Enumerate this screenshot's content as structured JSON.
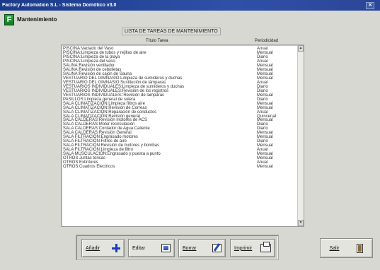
{
  "window": {
    "title": "Factory Automation S.L - Sistema Domótico v3.0",
    "close_symbol": "✕"
  },
  "app": {
    "icon_letter": "F",
    "section_title": "Mantenimiento"
  },
  "list": {
    "caption": "LISTA DE TAREAS DE MANTENIMIENTO",
    "columns": [
      "Título Tarea",
      "Periodicidad"
    ],
    "selected_index": 33,
    "rows": [
      {
        "task": "PISCINA:Vaciado del Vaso",
        "period": "Anual"
      },
      {
        "task": "PISCINA:Limpieza de tubos y rejillas de aire",
        "period": "Mensual"
      },
      {
        "task": "PISCINA:Limpieza de la playa",
        "period": "Diario"
      },
      {
        "task": "PISCINA:Limpieza del vaso",
        "period": "Anual"
      },
      {
        "task": "SAUNA:Revisión ventilador",
        "period": "Mensual"
      },
      {
        "task": "SAUNA:Revisión de cebolletas",
        "period": "Mensual"
      },
      {
        "task": "SAUNA:Revisión de cajón de Sauna",
        "period": "Mensual"
      },
      {
        "task": "VESTUARIO DEL GIMNASIO:Limpieza de sumideros y duchas",
        "period": "Mensual"
      },
      {
        "task": "VESTUARIO DEL GIMNASIO:Sustitución de lámparas",
        "period": "Anual"
      },
      {
        "task": "VESTUARIOS INDIVIDUALES:Limpieza de sumideros y duchas",
        "period": "Diario"
      },
      {
        "task": "VESTUARIOS INDIVIDUALES:Revisión de los registros",
        "period": "Diario"
      },
      {
        "task": "VESTUARIOS INDIVIDUALES::Revisión de lámparas",
        "period": "Mensual"
      },
      {
        "task": "PASILLOS:Limpieza general de solera",
        "period": "Diario"
      },
      {
        "task": "SALA CLIMATIZACIÓN:Limpieza filtros aire",
        "period": "Mensual"
      },
      {
        "task": "SALA CLIMATIZACIÓN:Revisión de Correas",
        "period": "Mensual"
      },
      {
        "task": "SALA CLIMATIZACIÓN:Reparación de conductos",
        "period": "Anual"
      },
      {
        "task": "SALA CLIMATIZACIÓN:Revisión general",
        "period": "Quincenal"
      },
      {
        "task": "SALA CALDERAS:Revisión motores de ACS",
        "period": "Mensual"
      },
      {
        "task": "SALA CALDERAS:Motor recirculación",
        "period": "Diario"
      },
      {
        "task": "SALA CALDERAS:Contador de Agua Caliente",
        "period": "Diario"
      },
      {
        "task": "SALA CALDERAS:Revisión General",
        "period": "Mensual"
      },
      {
        "task": "SALA FILTRACIÓN:Engrasado motores",
        "period": "Mensual"
      },
      {
        "task": "SALA FILTRACIÓN:Filtros de aire",
        "period": "Diario"
      },
      {
        "task": "SALA FILTRACIÓN:Revisión de motores y bombas",
        "period": "Mensual"
      },
      {
        "task": "SALA FILTRACIÓN:Limpieza de filtro",
        "period": "Anual"
      },
      {
        "task": "SALA MUSCULACIÓN:Engrasado y puesta a punto",
        "period": "Mensual"
      },
      {
        "task": "OTROS:Juntas tóricas",
        "period": "Mensual"
      },
      {
        "task": "OTROS:Extintores",
        "period": "Anual"
      },
      {
        "task": "OTROS:Cuadros Electricos",
        "period": "Mensual"
      }
    ]
  },
  "buttons": {
    "add": "Añadir",
    "edit": "Editar",
    "delete": "Borrar",
    "print": "Imprimir",
    "exit": "Salir"
  },
  "icons": {
    "add": "plus-icon",
    "edit": "edit-icon",
    "delete": "delete-icon",
    "print": "print-icon",
    "exit": "exit-door-icon"
  },
  "colors": {
    "selection": "#0a1e6e",
    "titlebar": "#1a3a8a",
    "app_icon": "#2aa53a"
  }
}
